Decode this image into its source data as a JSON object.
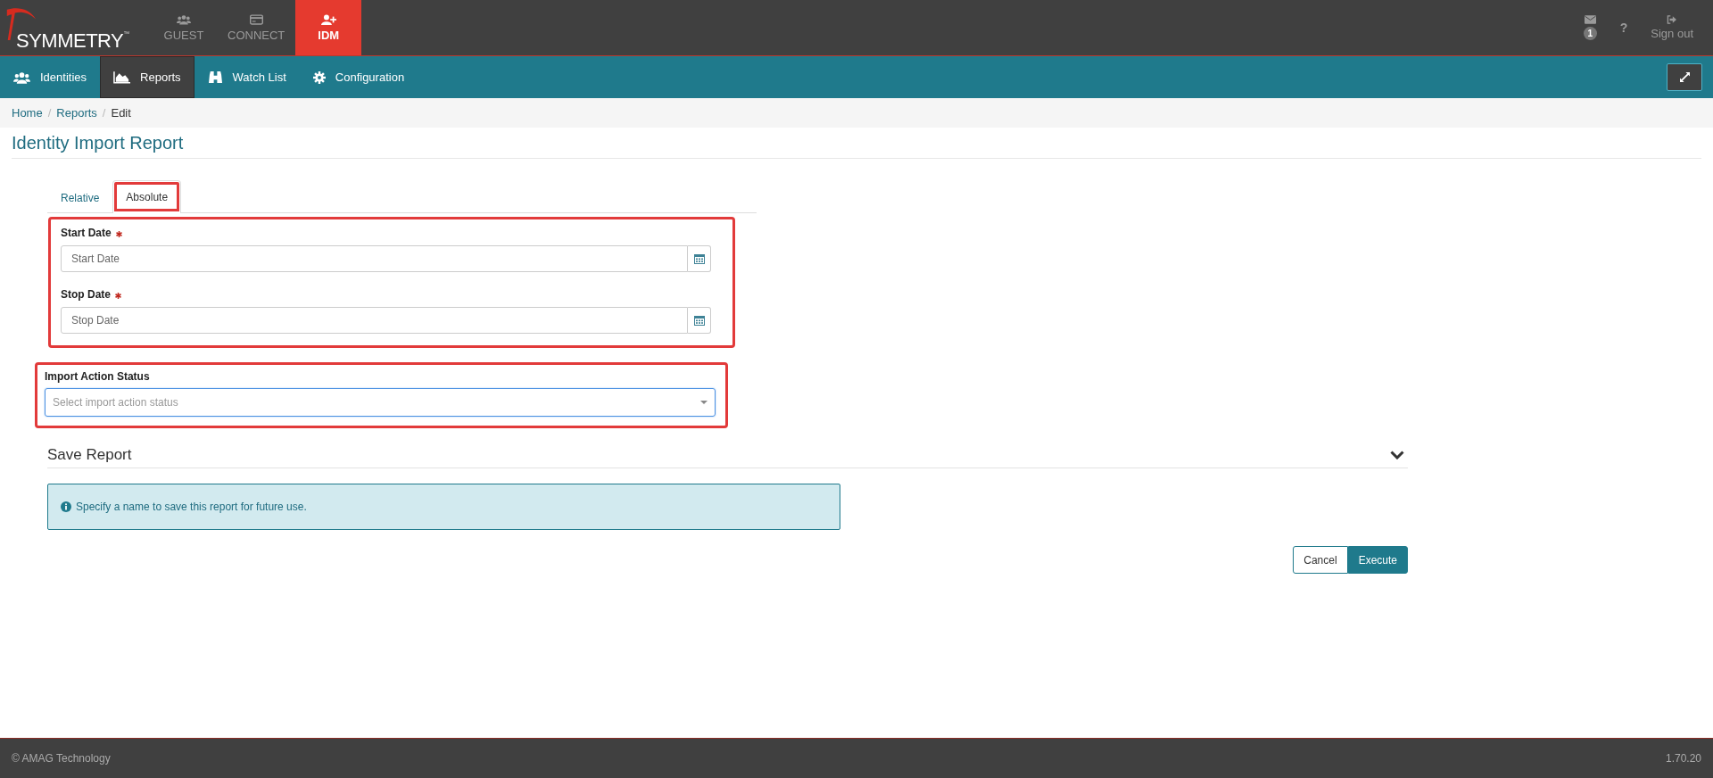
{
  "brand": {
    "name": "SYMMETRY",
    "mark": "™"
  },
  "apps": [
    {
      "label": "GUEST",
      "kind": "group",
      "selected": false
    },
    {
      "label": "CONNECT",
      "kind": "card",
      "selected": false
    },
    {
      "label": "IDM",
      "kind": "user-plus",
      "selected": true
    }
  ],
  "header_actions": {
    "mail_badge": "1",
    "help": "?",
    "sign_out": "Sign out"
  },
  "menu": [
    {
      "label": "Identities",
      "kind": "group",
      "selected": false
    },
    {
      "label": "Reports",
      "kind": "chart",
      "selected": true
    },
    {
      "label": "Watch List",
      "kind": "binoculars",
      "selected": false
    },
    {
      "label": "Configuration",
      "kind": "gear",
      "selected": false
    }
  ],
  "breadcrumb": [
    {
      "label": "Home",
      "kind": "link"
    },
    {
      "label": "/",
      "kind": "separator"
    },
    {
      "label": "Reports",
      "kind": "link"
    },
    {
      "label": "/",
      "kind": "separator"
    },
    {
      "label": "Edit",
      "kind": "current"
    }
  ],
  "page_title": "Identity Import Report",
  "tabs": [
    {
      "label": "Relative",
      "selected": false,
      "highlighted": false
    },
    {
      "label": "Absolute",
      "selected": true,
      "highlighted": true
    }
  ],
  "date_fields": {
    "highlighted": true,
    "fields": [
      {
        "label": "Start Date",
        "required": true,
        "placeholder": "Start Date"
      },
      {
        "label": "Stop Date",
        "required": true,
        "placeholder": "Stop Date"
      }
    ]
  },
  "status_field": {
    "highlighted": true,
    "focused": true,
    "label": "Import Action Status",
    "placeholder": "Select import action status"
  },
  "save_section": {
    "title": "Save Report"
  },
  "alert": "Specify a name to save this report for future use.",
  "buttons": [
    {
      "label": "Cancel",
      "kind": "default"
    },
    {
      "label": "Execute",
      "kind": "primary"
    }
  ],
  "footer": {
    "copyright": "© AMAG Technology",
    "version": "1.70.20"
  }
}
